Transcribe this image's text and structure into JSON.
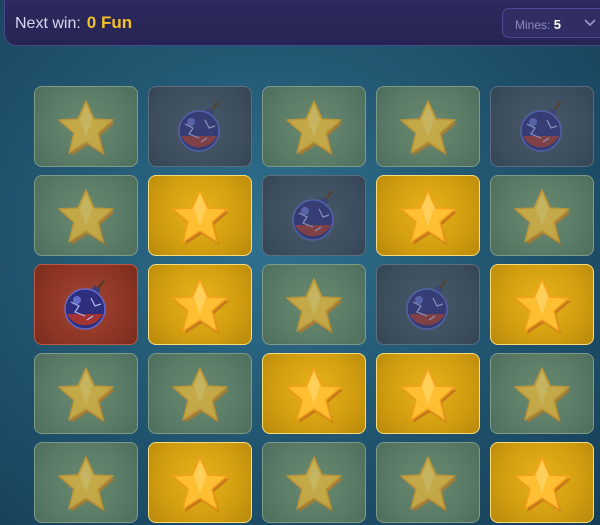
{
  "header": {
    "next_win_label": "Next win:",
    "next_win_value": "0 Fun"
  },
  "mines": {
    "label": "Mines:",
    "value": "5"
  },
  "icons": {
    "dropdown": "chevron-down-icon",
    "star": "star-icon",
    "mine": "bomb-icon"
  },
  "colors": {
    "accent": "#f5c128",
    "revealed_star_tile": "#d19d10",
    "hit_mine_tile": "#8c3524"
  },
  "board": {
    "rows": 5,
    "columns": 5,
    "tiles": [
      [
        "star-dim",
        "mine-dim",
        "star-dim",
        "star-dim",
        "mine-dim"
      ],
      [
        "star-dim",
        "star-win",
        "mine-dim",
        "star-win",
        "star-dim"
      ],
      [
        "mine-hit",
        "star-win",
        "star-dim",
        "mine-dim",
        "star-win"
      ],
      [
        "star-dim",
        "star-dim",
        "star-win",
        "star-win",
        "star-dim"
      ],
      [
        "star-dim",
        "star-win",
        "star-dim",
        "star-dim",
        "star-win"
      ]
    ]
  }
}
